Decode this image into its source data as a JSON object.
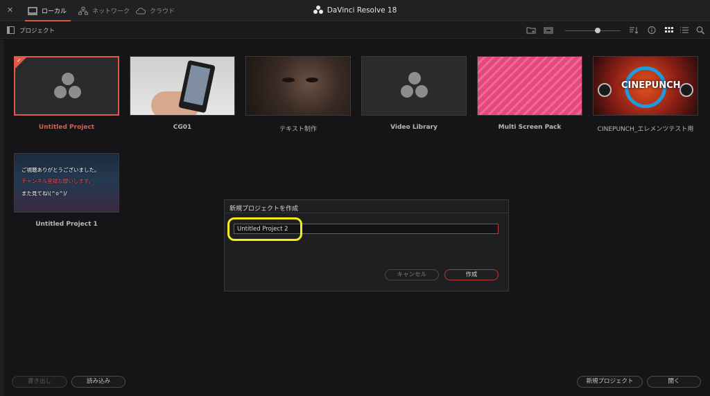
{
  "window": {
    "close_label": "✕",
    "app_title": "DaVinci Resolve 18"
  },
  "tabs": [
    {
      "label": "ローカル"
    },
    {
      "label": "ネットワーク"
    },
    {
      "label": "クラウド"
    }
  ],
  "toolbar": {
    "title": "プロジェクト",
    "zoom_level": 0.55
  },
  "projects": [
    {
      "name": "Untitled Project",
      "thumb": "resolve-logo",
      "selected": true
    },
    {
      "name": "CG01",
      "thumb": "phone"
    },
    {
      "name": "テキスト制作",
      "thumb": "face"
    },
    {
      "name": "Video Library",
      "thumb": "resolve-logo"
    },
    {
      "name": "Multi Screen Pack",
      "thumb": "pink"
    },
    {
      "name": "CINEPUNCH_エレメンツテスト用",
      "thumb": "cinepunch",
      "thumb_text": "CINEPUNCH"
    },
    {
      "name": "Untitled Project 1",
      "thumb": "room",
      "thumb_lines": [
        "ご視聴ありがとうございました。",
        "チャンネル登録お願いします。",
        "また見てね\\(^o^)/"
      ]
    }
  ],
  "dialog": {
    "title": "新規プロジェクトを作成",
    "input_value": "Untitled Project 2",
    "cancel_label": "キャンセル",
    "create_label": "作成"
  },
  "footer": {
    "export_label": "書き出し",
    "import_label": "読み込み",
    "new_project_label": "新規プロジェクト",
    "open_label": "開く"
  },
  "colors": {
    "accent": "#e05a47",
    "highlight": "#f2ef1a",
    "background": "#151517"
  }
}
